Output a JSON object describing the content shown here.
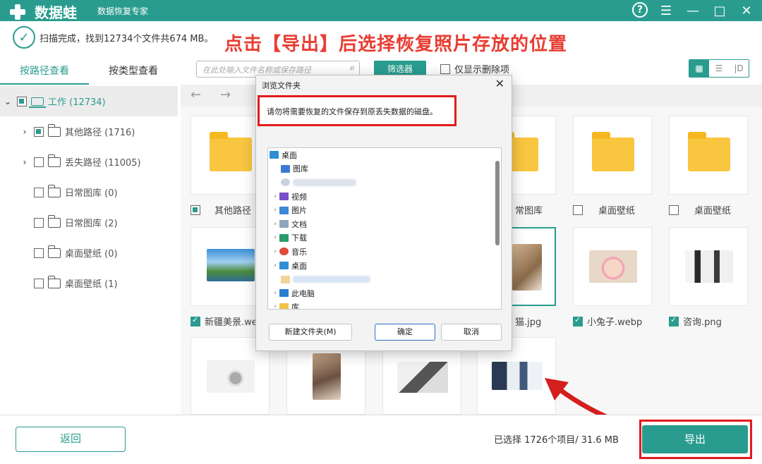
{
  "app": {
    "name": "数据蛙",
    "subtitle": "数据恢复专家"
  },
  "titlebar": {
    "icons": [
      "help-icon",
      "menu-icon",
      "minimize-icon",
      "maximize-icon",
      "close-icon"
    ]
  },
  "status": {
    "text": "扫描完成，找到12734个文件共674 MB。"
  },
  "annotation": {
    "text": "点击【导出】后选择恢复照片存放的位置"
  },
  "left_tabs": [
    {
      "label": "按路径查看"
    },
    {
      "label": "按类型查看"
    }
  ],
  "tree": {
    "root": {
      "label": "工作 (12734)"
    },
    "items": [
      {
        "label": "其他路径 (1716)"
      },
      {
        "label": "丢失路径 (11005)"
      },
      {
        "label": "日常图库 (0)"
      },
      {
        "label": "日常图库 (2)"
      },
      {
        "label": "桌面壁纸 (0)"
      },
      {
        "label": "桌面壁纸 (1)"
      }
    ]
  },
  "toolbar": {
    "search_placeholder": "在此处输入文件名称或保存路径",
    "filter_label": "筛选器",
    "deleted_only_label": "仅显示删除项",
    "view_icons": [
      "grid-view-icon",
      "list-view-icon",
      "detail-view-icon"
    ]
  },
  "grid": {
    "row1": [
      {
        "caption": "其他路径"
      },
      {
        "caption": "常图库"
      },
      {
        "caption": "桌面壁纸"
      },
      {
        "caption": "桌面壁纸"
      }
    ],
    "row2": [
      {
        "caption": "新疆美景.we"
      },
      {
        "caption": "猫.jpg"
      },
      {
        "caption": "小兔子.webp"
      },
      {
        "caption": "咨询.png"
      }
    ]
  },
  "dialog": {
    "title": "浏览文件夹",
    "warning": "请勿将需要恢复的文件保存到原丢失数据的磁盘。",
    "items": [
      {
        "label": "桌面"
      },
      {
        "label": "图库"
      },
      {
        "label": "视频"
      },
      {
        "label": "图片"
      },
      {
        "label": "文档"
      },
      {
        "label": "下载"
      },
      {
        "label": "音乐"
      },
      {
        "label": "桌面"
      },
      {
        "label": "此电脑"
      },
      {
        "label": "库"
      }
    ],
    "new_folder_label": "新建文件夹(M)",
    "ok_label": "确定",
    "cancel_label": "取消"
  },
  "bottom": {
    "back_label": "返回",
    "selection_info": "已选择 1726个项目/ 31.6 MB",
    "export_label": "导出"
  },
  "colors": {
    "accent": "#2a9c8f",
    "annotation_red": "#e83d32",
    "highlight_border": "#e21b1b",
    "folder_yellow": "#f9c640"
  }
}
